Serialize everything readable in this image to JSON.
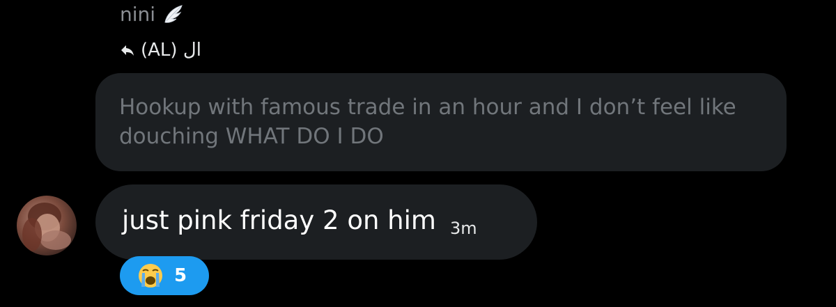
{
  "sender": {
    "name": "nini",
    "badge_icon": "angel-wing-icon"
  },
  "reply_context": {
    "icon": "reply-arrow-icon",
    "text": "(AL) ال"
  },
  "quoted_message": {
    "text": "Hookup with famous trade in an hour and I don’t feel like douching WHAT DO I DO"
  },
  "message": {
    "avatar": "user-avatar",
    "text": "just pink friday 2 on him",
    "timestamp": "3m"
  },
  "reaction": {
    "icon": "loudly-crying-face-icon",
    "count": "5",
    "color": "#1d9bf0"
  },
  "colors": {
    "background": "#000000",
    "bubble": "#1c1f22",
    "muted_text": "#71767b",
    "accent": "#1d9bf0"
  }
}
